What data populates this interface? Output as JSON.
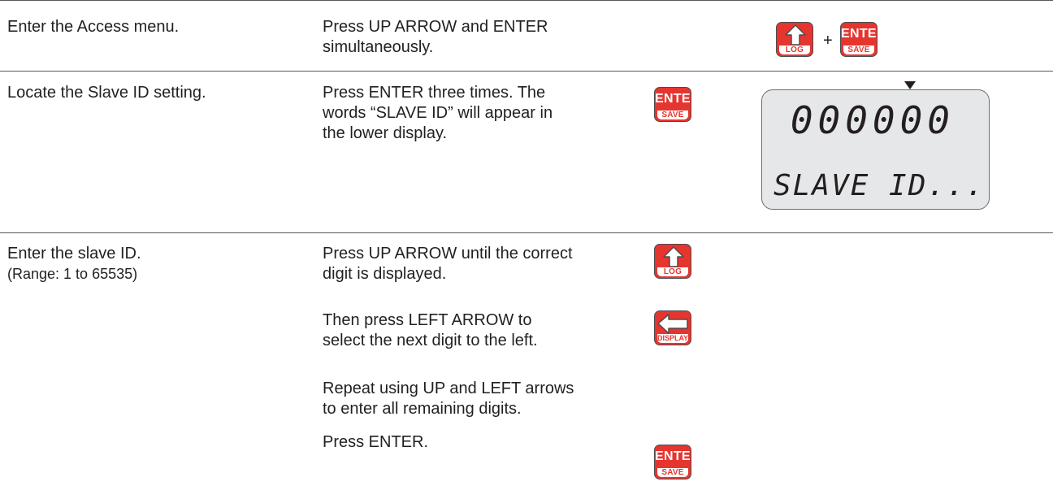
{
  "rows": [
    {
      "action": "Enter the Access menu.",
      "instruction_lines": [
        "Press UP ARROW and ENTER",
        "simultaneously."
      ],
      "combo": {
        "plus": "+"
      }
    },
    {
      "action": "Locate the Slave ID setting.",
      "instruction_lines": [
        "Press ENTER three times. The",
        "words “SLAVE ID” will appear in",
        "the lower display."
      ],
      "display": {
        "upper": "000000",
        "lower": "SLAVE ID..."
      }
    },
    {
      "action_lines": [
        "Enter the slave ID.",
        "(Range: 1 to 65535)"
      ],
      "steps": [
        {
          "lines": [
            "Press UP ARROW until the correct",
            "digit is displayed."
          ]
        },
        {
          "lines": [
            "Then press LEFT ARROW to",
            "select the next digit to the left."
          ]
        },
        {
          "lines": [
            "Repeat using UP and LEFT arrows",
            "to enter all remaining digits."
          ]
        },
        {
          "lines": [
            "Press ENTER."
          ]
        }
      ]
    }
  ],
  "keys": {
    "up": {
      "sublabel": "LOG"
    },
    "enter": {
      "label": "ENTER",
      "sublabel": "SAVE"
    },
    "left": {
      "sublabel": "DISPLAY"
    }
  },
  "colors": {
    "key_red": "#e6352f",
    "text": "#231f20",
    "lcd_bg": "#e6e7e8",
    "rule": "#58595b"
  }
}
